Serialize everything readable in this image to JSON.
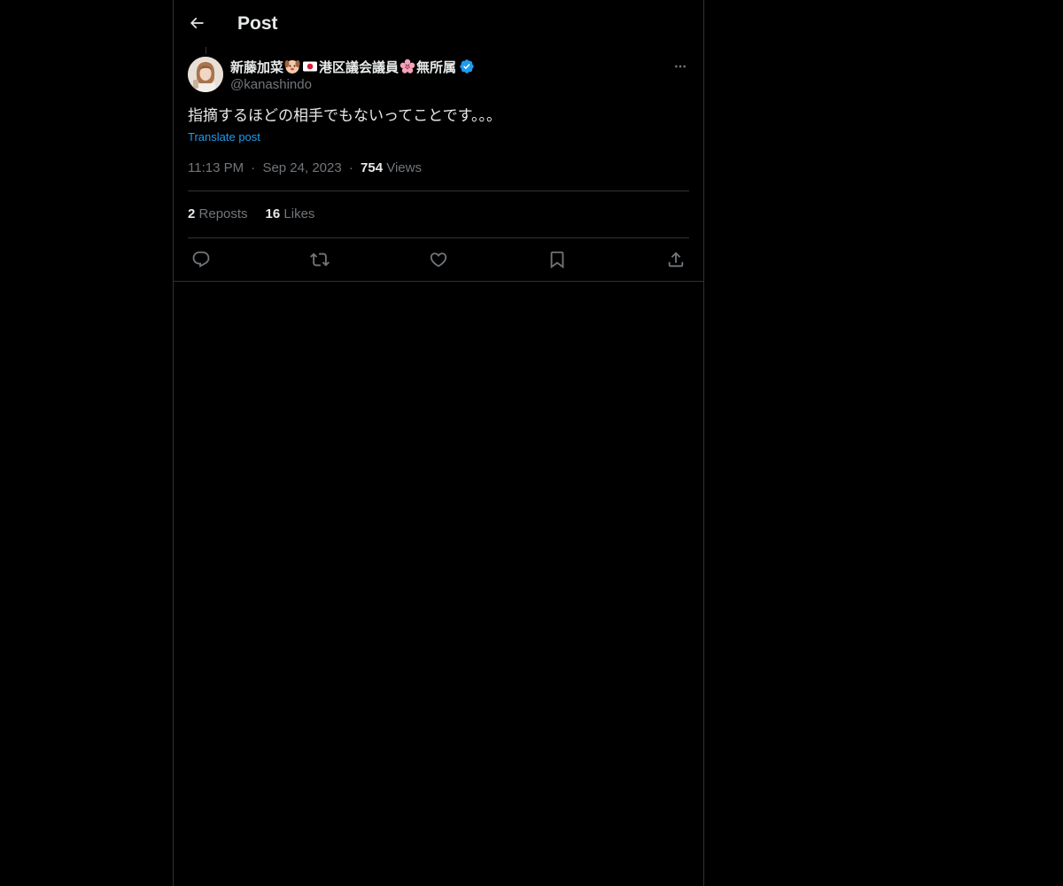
{
  "header": {
    "title": "Post",
    "back_icon": "arrow-left-icon"
  },
  "tweet": {
    "author": {
      "name_part1": "新藤加菜",
      "name_part2": "港区議会議員",
      "name_part3": "無所属",
      "handle": "@kanashindo",
      "verified": true,
      "emojis": [
        "dog-face-emoji",
        "japan-flag-emoji",
        "cherry-blossom-emoji"
      ]
    },
    "text": "指摘するほどの相手でもないってことです。。。",
    "translate_label": "Translate post",
    "time": "11:13 PM",
    "date": "Sep 24, 2023",
    "separator": "·",
    "views_count": "754",
    "views_label": "Views",
    "reposts_count": "2",
    "reposts_label": "Reposts",
    "likes_count": "16",
    "likes_label": "Likes"
  },
  "actions": [
    "reply-icon",
    "repost-icon",
    "like-icon",
    "bookmark-icon",
    "share-icon"
  ],
  "colors": {
    "background": "#000000",
    "text": "#e7e9ea",
    "secondary": "#71767b",
    "accent": "#1d9bf0",
    "border": "#2f3336"
  }
}
